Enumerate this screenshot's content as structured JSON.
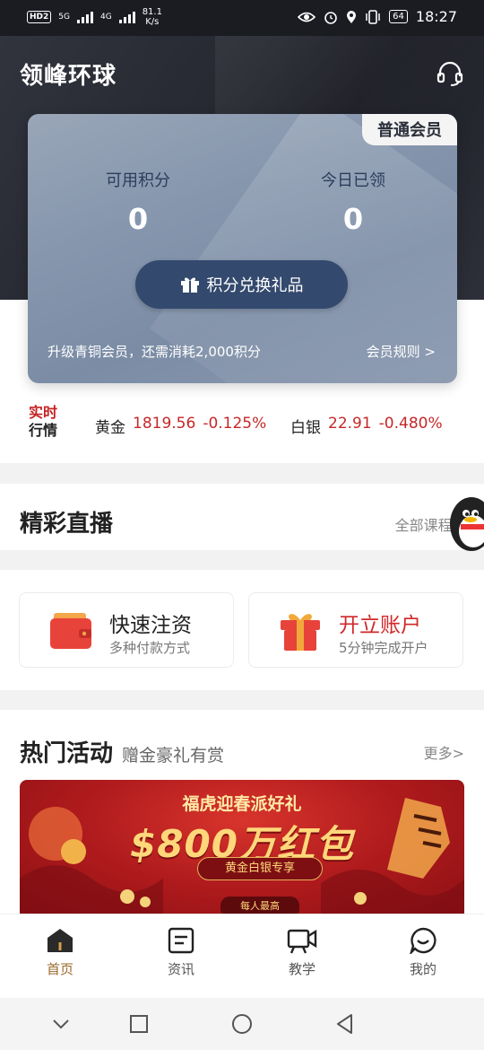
{
  "status_bar": {
    "hd_badge": "HD",
    "hd_number": "2",
    "network1": "5G",
    "network2": "4G",
    "speed_value": "81.1",
    "speed_unit": "K/s",
    "battery": "64",
    "time": "18:27"
  },
  "header": {
    "app_title": "领峰环球"
  },
  "member_card": {
    "level_badge": "普通会员",
    "available_points_label": "可用积分",
    "available_points_value": "0",
    "today_points_label": "今日已领",
    "today_points_value": "0",
    "redeem_button": "积分兑换礼品",
    "upgrade_hint": "升级青铜会员，还需消耗2,000积分",
    "rules_link": "会员规则 >"
  },
  "market": {
    "logo_line1": "实时",
    "logo_line2": "行情",
    "items": [
      {
        "name": "黄金",
        "price": "1819.56",
        "change": "-0.125%"
      },
      {
        "name": "白银",
        "price": "22.91",
        "change": "-0.480%"
      }
    ]
  },
  "live": {
    "title": "精彩直播",
    "more": "全部课程>"
  },
  "quick_actions": [
    {
      "title": "快速注资",
      "subtitle": "多种付款方式",
      "icon": "wallet-icon"
    },
    {
      "title": "开立账户",
      "subtitle": "5分钟完成开户",
      "icon": "gift-box-icon"
    }
  ],
  "activities": {
    "title": "热门活动",
    "subtitle": "赠金豪礼有赏",
    "more": "更多>",
    "banner": {
      "top_text": "福虎迎春派好礼",
      "main_text": "$800万红包",
      "tag": "黄金白银专享",
      "footer": "每人最高"
    }
  },
  "tabbar": [
    {
      "label": "首页",
      "icon": "home-icon",
      "active": true
    },
    {
      "label": "资讯",
      "icon": "news-icon",
      "active": false
    },
    {
      "label": "教学",
      "icon": "video-camera-icon",
      "active": false
    },
    {
      "label": "我的",
      "icon": "chat-smile-icon",
      "active": false
    }
  ],
  "colors": {
    "accent_red": "#c62828",
    "tab_active": "#9a6a2a",
    "card_button": "#33496d"
  }
}
